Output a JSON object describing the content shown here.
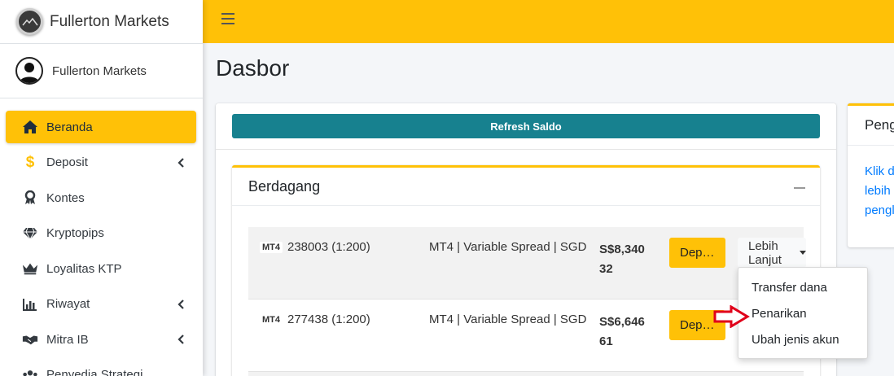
{
  "brand": {
    "name": "Fullerton Markets"
  },
  "user": {
    "name": "Fullerton Markets"
  },
  "sidebar": {
    "items": [
      {
        "label": "Beranda",
        "icon": "home-icon"
      },
      {
        "label": "Deposit",
        "icon": "dollar-icon"
      },
      {
        "label": "Kontes",
        "icon": "award-icon"
      },
      {
        "label": "Kryptopips",
        "icon": "gem-icon"
      },
      {
        "label": "Loyalitas KTP",
        "icon": "crown-icon"
      },
      {
        "label": "Riwayat",
        "icon": "chart-bar-icon"
      },
      {
        "label": "Mitra IB",
        "icon": "handshake-icon"
      },
      {
        "label": "Penyedia Strategi",
        "icon": "users-icon"
      }
    ]
  },
  "header": {
    "menu_icon": "hamburger-icon"
  },
  "page": {
    "title": "Dasbor"
  },
  "main": {
    "refresh_label": "Refresh Saldo",
    "trading": {
      "title": "Berdagang",
      "accounts": [
        {
          "platform": "MT4",
          "id": "238003 (1:200)",
          "type": "MT4 | Variable Spread | SGD",
          "balance_line1": "S$8,340",
          "balance_line2": "32",
          "deposit_label": "Dep…",
          "more_label": "Lebih Lanjut"
        },
        {
          "platform": "MT4",
          "id": "277438 (1:200)",
          "type": "MT4 | Variable Spread | SGD",
          "balance_line1": "S$6,646",
          "balance_line2": "61",
          "deposit_label": "Dep…"
        }
      ]
    }
  },
  "dropdown": {
    "items": [
      "Transfer dana",
      "Penarikan",
      "Ubah jenis akun"
    ]
  },
  "side_card": {
    "title": "Peng",
    "lines": [
      "Klik d",
      "lebih",
      "pengl"
    ]
  },
  "colors": {
    "accent": "#ffc107",
    "refresh": "#17818f",
    "link": "#007bff",
    "arrow": "#e0001a"
  }
}
